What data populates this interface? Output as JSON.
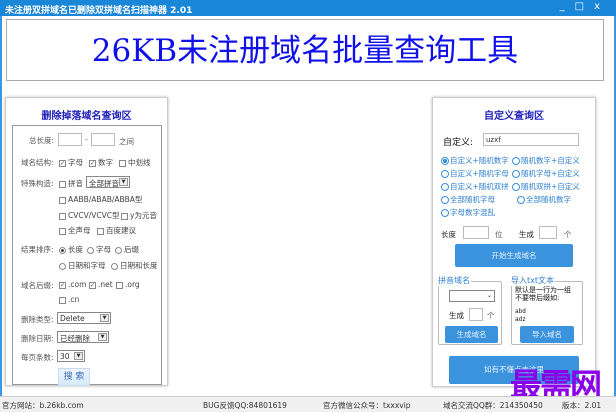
{
  "window": {
    "title": "未注册双拼域名已删除双拼域名扫描神器  2.01",
    "controls": [
      "_",
      "□",
      "x"
    ]
  },
  "banner": {
    "text": "26KB未注册域名批量查询工具",
    "color": "#1010e8"
  },
  "left": {
    "title": "删除掉落域名查询区",
    "length": {
      "label": "总长度:",
      "sep": "-",
      "suffix": "之间",
      "min": "",
      "max": ""
    },
    "structure": {
      "label": "域名结构:",
      "options": [
        {
          "label": "字母",
          "checked": true
        },
        {
          "label": "数字",
          "checked": true
        },
        {
          "label": "中划线",
          "checked": false
        }
      ]
    },
    "special": {
      "label": "特殊构造:",
      "pinyin": {
        "label": "拼音",
        "checked": false
      },
      "pinyin_select": "全部拼音",
      "options": [
        {
          "label": "AABB/ABAB/ABBA型",
          "checked": false
        },
        {
          "label": "CVCV/VCVC型",
          "checked": false
        },
        {
          "label": "y为元音",
          "checked": false
        },
        {
          "label": "全声母",
          "checked": false
        },
        {
          "label": "百度建议",
          "checked": false
        }
      ]
    },
    "sort": {
      "label": "结果排序:",
      "options": [
        {
          "label": "长度",
          "selected": true
        },
        {
          "label": "字母",
          "selected": false
        },
        {
          "label": "后缀",
          "selected": false
        },
        {
          "label": "日期和字母",
          "selected": false
        },
        {
          "label": "日期和长度",
          "selected": false
        }
      ]
    },
    "suffix": {
      "label": "域名后缀:",
      "options": [
        {
          "label": ".com",
          "checked": true
        },
        {
          "label": ".net",
          "checked": true
        },
        {
          "label": ".org",
          "checked": false
        },
        {
          "label": ".cn",
          "checked": false
        }
      ]
    },
    "del_type": {
      "label": "删除类型:",
      "value": "Delete"
    },
    "del_date": {
      "label": "删除日期:",
      "value": "已经删除"
    },
    "per_page": {
      "label": "每页条数:",
      "value": "30"
    },
    "search_button": "搜 索"
  },
  "right": {
    "title": "自定义查询区",
    "custom": {
      "label": "自定义:",
      "value": "uzxf"
    },
    "modes": [
      {
        "label": "自定义+随机数字",
        "selected": true
      },
      {
        "label": "随机数字+自定义",
        "selected": false
      },
      {
        "label": "自定义+随机字母",
        "selected": false
      },
      {
        "label": "随机字母+自定义",
        "selected": false
      },
      {
        "label": "自定义+随机双拼",
        "selected": false
      },
      {
        "label": "随机双拼+自定义",
        "selected": false
      },
      {
        "label": "全部随机字母",
        "selected": false
      },
      {
        "label": "全部随机数字",
        "selected": false
      },
      {
        "label": "字母数字混乱",
        "selected": false
      }
    ],
    "length_label": "长度",
    "length_unit": "位",
    "length_value": "",
    "gen_label": "生成",
    "gen_unit": "个",
    "gen_value": "",
    "start_button": "开始生成域名",
    "pinyin_group": {
      "legend": "拼音域名",
      "select": "",
      "gen_label": "生成",
      "gen_unit": "个",
      "gen_value": "",
      "button": "生成域名"
    },
    "import_group": {
      "legend": "导入txt文本",
      "hint": "默认是一行为一组\n不要带后缀如:",
      "sample": "abd\nadz",
      "button": "导入域名"
    },
    "help_button": "如有不懂点击这里"
  },
  "status": {
    "website": "官方网站：b.26kb.com",
    "bug": "BUG反馈QQ:84801619",
    "wechat": "官方微信公众号：txxxvip",
    "group": "域名交流QQ群：214350450",
    "version": "版本：2.01"
  },
  "watermark": "最需网",
  "colors": {
    "titlebar": "#1a86d8",
    "accent_button": "#3a93dc",
    "banner_text": "#1010e8",
    "watermark": "#8a00e8"
  }
}
